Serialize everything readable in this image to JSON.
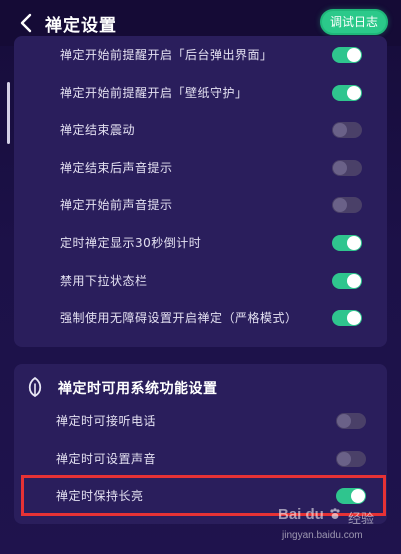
{
  "header": {
    "title": "禅定设置",
    "debug_button_label": "调试日志"
  },
  "main": {
    "settings": [
      {
        "label": "禅定开始前提醒开启「后台弹出界面」",
        "enabled": true
      },
      {
        "label": "禅定开始前提醒开启「壁纸守护」",
        "enabled": true
      },
      {
        "label": "禅定结束震动",
        "enabled": false
      },
      {
        "label": "禅定结束后声音提示",
        "enabled": false
      },
      {
        "label": "禅定开始前声音提示",
        "enabled": false
      },
      {
        "label": "定时禅定显示30秒倒计时",
        "enabled": true
      },
      {
        "label": "禁用下拉状态栏",
        "enabled": true
      },
      {
        "label": "强制使用无障碍设置开启禅定（严格模式）",
        "enabled": true
      }
    ]
  },
  "system_section": {
    "title": "禅定时可用系统功能设置",
    "icon": "leaf-icon",
    "settings": [
      {
        "label": "禅定时可接听电话",
        "enabled": false
      },
      {
        "label": "禅定时可设置声音",
        "enabled": false
      },
      {
        "label": "禅定时保持长亮",
        "enabled": true
      }
    ]
  },
  "watermark": {
    "logo": "Bai du",
    "text": "经验",
    "url": "jingyan.baidu.com"
  },
  "colors": {
    "accent": "#2fc58e",
    "background": "#1c1148",
    "card": "#2a1e5c",
    "highlight_border": "#e63235"
  }
}
